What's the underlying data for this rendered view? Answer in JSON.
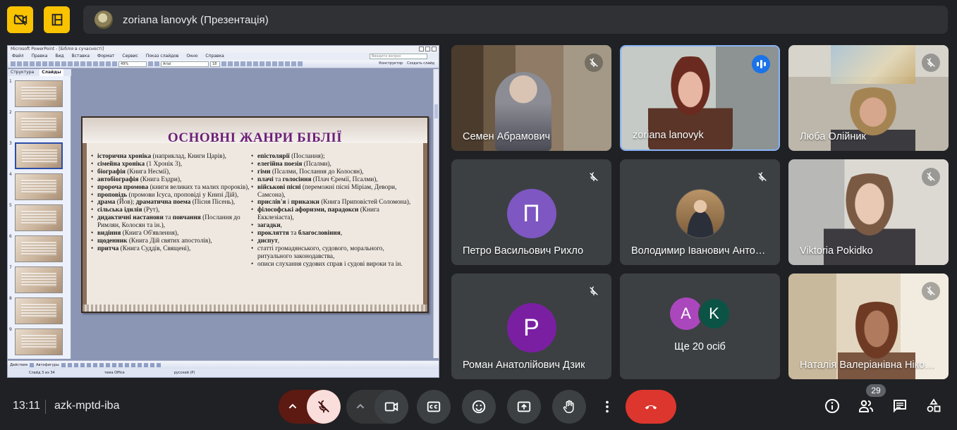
{
  "top_bar": {
    "presenter_text": "zoriana lanovyk (Презентація)",
    "left_buttons": [
      "camera-off-icon",
      "pin-layout-icon"
    ],
    "accent_color": "#f9c300"
  },
  "presentation": {
    "window_title": "Microsoft PowerPoint - [Біблія в сучасності]",
    "menu": [
      "Файл",
      "Правка",
      "Вид",
      "Вставка",
      "Формат",
      "Сервис",
      "Показ слайдов",
      "Окно",
      "Справка"
    ],
    "ask_placeholder": "Введите вопрос",
    "font_size_field": "49%",
    "font_field": "Arial",
    "font_size": "18",
    "toolbar_right": [
      "Конструктор",
      "Создать слайд"
    ],
    "tabs": [
      "Структура",
      "Слайды"
    ],
    "slide_numbers": [
      "1",
      "2",
      "3",
      "4",
      "5",
      "6",
      "7",
      "8",
      "9"
    ],
    "drawing_toolbar": [
      "Действия",
      "Автофигуры"
    ],
    "status": [
      "Слайд 3 из 34",
      "тема Office",
      "русский (Р)"
    ],
    "slide": {
      "heading": "ОСНОВНІ ЖАНРИ БІБЛІЇ",
      "left": [
        {
          "b": "історична хроніка",
          "t": " (наприклад, Книги Царів),"
        },
        {
          "b": "сімейна хроніка",
          "t": " (1 Хронік 3),"
        },
        {
          "b": "біографія",
          "t": " (Книга Несмії),"
        },
        {
          "b": "автобіографія",
          "t": " (Книга Ездри),"
        },
        {
          "b": "пророча промова",
          "t": " (книги великих та малих пророків),"
        },
        {
          "b": "проповідь",
          "t": " (промови Ісуса, проповіді у Книзі Дій),"
        },
        {
          "b": "драма",
          "t": " (Йов); ",
          "b2": "драматична поема",
          "t2": " (Пісня Пісень),"
        },
        {
          "b": "сільська ідилія",
          "t": " (Рут),"
        },
        {
          "b": "дидактичні настанови",
          "t": " та ",
          "b2": "повчання",
          "t2": " (Послання до Римлян, Колосян та ін.),"
        },
        {
          "b": "видіння",
          "t": " (Книга Об'явлення),"
        },
        {
          "b": "щоденник",
          "t": " (Книга Дій святих апостолів),"
        },
        {
          "b": "притча",
          "t": " (Книга Суддів, Священі),"
        }
      ],
      "right": [
        {
          "b": "епістолярії",
          "t": " (Послання);"
        },
        {
          "b": "елегійна поезія",
          "t": " (Псалми),"
        },
        {
          "b": "гімн",
          "t": " (Псалми, Послання до Колосян),"
        },
        {
          "b": "плачі",
          "t": " та ",
          "b2": "голосіння",
          "t2": " (Плач Єремії, Псалми),"
        },
        {
          "b": "військові пісні",
          "t": " (переможні пісні Міріам, Девори, Самсона),"
        },
        {
          "b": "прислів'я",
          "t": " і ",
          "b2": "приказки",
          "t2": " (Книга Приповістей Соломона),"
        },
        {
          "b": "філософські афоризми,  парадокси",
          "t": " (Книга Екклезіаста),"
        },
        {
          "b": "загадки",
          "t": ","
        },
        {
          "b": "прокляття",
          "t": " та ",
          "b2": "благословіння",
          "t2": ","
        },
        {
          "b": "диспут",
          "t": ","
        },
        {
          "b": "",
          "t": "статті громадянського, судового, морального, ритуального законодавства,"
        },
        {
          "b": "",
          "t": "описи слухання судових справ і судові вироки та ін."
        }
      ]
    }
  },
  "participants": [
    {
      "name": "Семен Абрамович",
      "muted": true
    },
    {
      "name": "zoriana lanovyk",
      "speaking": true
    },
    {
      "name": "Люба Олійник",
      "muted": true
    },
    {
      "name": "Петро Васильович Рихло",
      "muted": true,
      "avatar_letter": "П",
      "avatar_color": "#7e57c2"
    },
    {
      "name": "Володимир Іванович Антофійчук",
      "muted": true
    },
    {
      "name": "Viktoria Pokidko",
      "muted": true
    },
    {
      "name": "Роман Анатолійович Дзик",
      "muted": true,
      "avatar_letter": "Р",
      "avatar_color": "#7b1fa2"
    },
    {
      "more_label": "Ще 20 осіб",
      "avatars": [
        {
          "letter": "A",
          "color": "#ab47bc"
        },
        {
          "letter": "K",
          "color": "#0b5345"
        }
      ]
    },
    {
      "name": "Наталія Валеріанівна Ніконенко",
      "muted": true
    }
  ],
  "bottom_bar": {
    "time": "13:11",
    "meeting_code": "azk-mptd-iba",
    "participant_count": "29",
    "leave_color": "#dc362e",
    "controls": [
      "more-options-arrow",
      "mic-off",
      "camera-options-arrow",
      "camera",
      "captions",
      "emoji",
      "present",
      "raise-hand",
      "more-options",
      "leave-call"
    ],
    "right_controls": [
      "info",
      "people",
      "chat",
      "activities"
    ]
  }
}
